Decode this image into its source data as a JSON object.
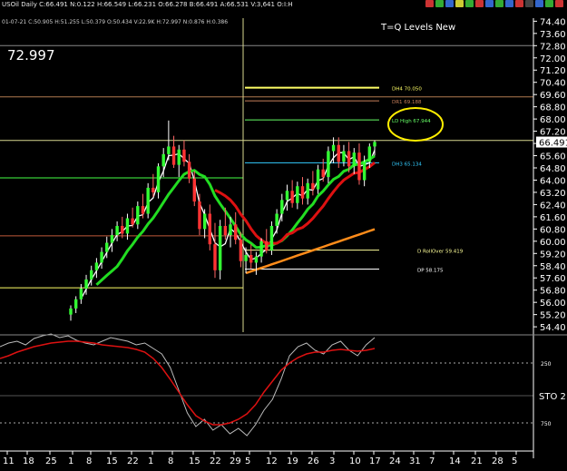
{
  "window": {
    "title_line": "USOil Daily  C:66.491  N:0.122  H:66.549  L:66.231  O:66.278  B:66.491  A:66.531  V:3,641  O:I:H",
    "sub_line": "01-07-21  C:50.905  H:51.255  L:50.379  O:50.434  V:22.9K  H:72.997  N:0.876  H:0.386",
    "top_icons": [
      "red",
      "green",
      "blue",
      "yellow",
      "green",
      "red",
      "blue",
      "green",
      "blue",
      "red",
      "gray",
      "blue",
      "green",
      "red"
    ]
  },
  "chart_data": {
    "type": "candlestick",
    "price_label": "72.997",
    "annotation_title": "T=Q Levels New",
    "y_range": [
      54.05,
      74.6
    ],
    "y_ticks": [
      "74.40",
      "73.60",
      "72.80",
      "72.00",
      "71.20",
      "70.40",
      "69.60",
      "68.80",
      "68.00",
      "67.20",
      "66.40",
      "65.60",
      "64.80",
      "64.00",
      "63.20",
      "62.40",
      "61.60",
      "60.80",
      "60.00",
      "59.20",
      "58.40",
      "57.60",
      "56.80",
      "56.00",
      "55.20",
      "54.40"
    ],
    "last_price": "66.491",
    "x_labels": [
      "11",
      "18",
      "25",
      "1",
      "8",
      "15",
      "22",
      "1",
      "8",
      "15",
      "22",
      "29",
      "5",
      "12",
      "19",
      "26",
      "3",
      "10",
      "17",
      "24",
      "31",
      "7",
      "14",
      "21",
      "28",
      "5"
    ],
    "levels": [
      {
        "label": "DH4 70.050",
        "value": 70.05,
        "color": "#ffff66"
      },
      {
        "label": "DR1 69.188",
        "value": 69.188,
        "color": "#c87f5a"
      },
      {
        "label": "LD High 67.944",
        "value": 67.944,
        "color": "#66ff66"
      },
      {
        "label": "DH3 65.134",
        "value": 65.134,
        "color": "#33ccff"
      },
      {
        "label": "D RollOver 59.419",
        "value": 59.419,
        "color": "#ffff99"
      },
      {
        "label": "DP 58.175",
        "value": 58.175,
        "color": "#ffffff"
      }
    ],
    "candles": [
      [
        55.2,
        55.8,
        54.8,
        55.6
      ],
      [
        55.6,
        56.4,
        55.3,
        56.2
      ],
      [
        56.2,
        57.2,
        55.9,
        56.9
      ],
      [
        56.9,
        57.8,
        56.5,
        57.5
      ],
      [
        57.5,
        58.4,
        57.1,
        58.1
      ],
      [
        58.1,
        58.9,
        57.6,
        58.6
      ],
      [
        58.6,
        59.6,
        58.2,
        59.3
      ],
      [
        59.3,
        60.3,
        58.9,
        59.9
      ],
      [
        59.9,
        60.8,
        59.3,
        60.4
      ],
      [
        60.4,
        61.3,
        60.0,
        61.0
      ],
      [
        61.0,
        61.6,
        60.2,
        60.5
      ],
      [
        60.5,
        61.8,
        60.1,
        61.5
      ],
      [
        61.5,
        62.2,
        60.9,
        61.1
      ],
      [
        61.1,
        62.6,
        60.8,
        62.3
      ],
      [
        62.3,
        63.1,
        61.5,
        61.8
      ],
      [
        61.8,
        63.8,
        61.5,
        63.5
      ],
      [
        63.5,
        64.4,
        62.9,
        63.2
      ],
      [
        63.2,
        65.1,
        62.8,
        64.9
      ],
      [
        64.9,
        66.1,
        64.2,
        65.7
      ],
      [
        65.7,
        67.9,
        65.3,
        66.2
      ],
      [
        66.2,
        66.9,
        64.8,
        65.0
      ],
      [
        65.0,
        66.3,
        64.2,
        66.0
      ],
      [
        66.0,
        66.6,
        64.9,
        65.2
      ],
      [
        65.2,
        65.7,
        63.8,
        64.1
      ],
      [
        64.1,
        64.6,
        62.3,
        62.6
      ],
      [
        62.6,
        63.1,
        60.4,
        60.8
      ],
      [
        60.8,
        62.1,
        60.2,
        61.8
      ],
      [
        61.8,
        62.4,
        59.4,
        59.8
      ],
      [
        59.8,
        61.2,
        57.6,
        58.1
      ],
      [
        58.1,
        61.4,
        57.5,
        61.0
      ],
      [
        61.0,
        62.2,
        60.1,
        60.4
      ],
      [
        60.4,
        61.6,
        59.6,
        61.1
      ],
      [
        61.1,
        61.9,
        59.8,
        60.1
      ],
      [
        60.1,
        60.6,
        58.3,
        58.7
      ],
      [
        58.7,
        59.6,
        57.9,
        59.1
      ],
      [
        59.1,
        59.8,
        58.2,
        58.6
      ],
      [
        58.6,
        59.3,
        57.8,
        59.0
      ],
      [
        59.0,
        60.2,
        58.6,
        60.0
      ],
      [
        60.0,
        60.8,
        59.2,
        59.4
      ],
      [
        59.4,
        61.3,
        59.1,
        61.0
      ],
      [
        61.0,
        62.1,
        60.5,
        61.8
      ],
      [
        61.8,
        63.1,
        61.3,
        62.7
      ],
      [
        62.7,
        63.7,
        62.0,
        63.3
      ],
      [
        63.3,
        64.0,
        62.2,
        62.5
      ],
      [
        62.5,
        63.9,
        62.1,
        63.6
      ],
      [
        63.6,
        64.2,
        62.4,
        62.8
      ],
      [
        62.8,
        64.1,
        62.4,
        63.8
      ],
      [
        63.8,
        64.6,
        63.0,
        63.4
      ],
      [
        63.4,
        65.0,
        63.1,
        64.7
      ],
      [
        64.7,
        65.4,
        63.9,
        64.2
      ],
      [
        64.2,
        66.2,
        63.8,
        65.9
      ],
      [
        65.9,
        66.8,
        65.1,
        66.3
      ],
      [
        66.3,
        66.8,
        64.8,
        65.2
      ],
      [
        65.2,
        66.3,
        64.9,
        65.9
      ],
      [
        65.9,
        66.5,
        64.5,
        64.9
      ],
      [
        64.9,
        66.1,
        64.4,
        65.8
      ],
      [
        65.8,
        66.4,
        63.7,
        64.0
      ],
      [
        64.0,
        65.6,
        63.6,
        65.2
      ],
      [
        65.2,
        66.4,
        64.8,
        66.2
      ],
      [
        66.2,
        66.6,
        65.6,
        66.5
      ]
    ],
    "stochastic_label": "STO 2",
    "osc_levels": [
      "250",
      "750"
    ]
  }
}
